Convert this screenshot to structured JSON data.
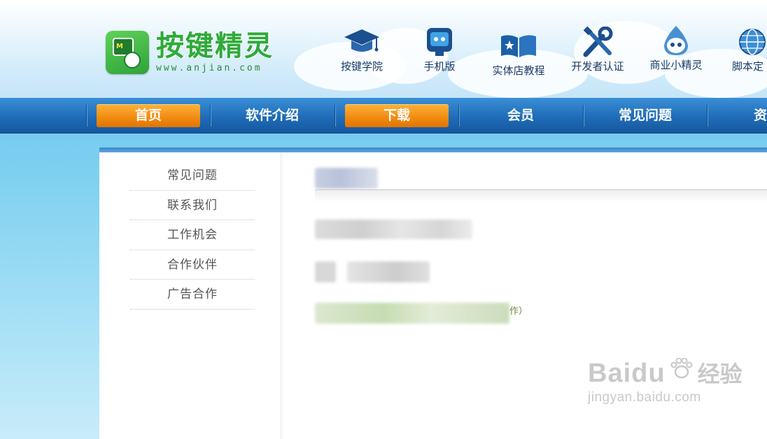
{
  "logo": {
    "title": "按键精灵",
    "mark_letter": "M",
    "url": "www.anjian.com"
  },
  "quick_links": [
    {
      "label": "按键学院",
      "icon": "graduation-cap-icon"
    },
    {
      "label": "手机版",
      "icon": "robot-phone-icon"
    },
    {
      "label": "实体店教程",
      "icon": "open-book-icon"
    },
    {
      "label": "开发者认证",
      "icon": "tools-icon"
    },
    {
      "label": "商业小精灵",
      "icon": "elf-mascot-icon"
    },
    {
      "label": "脚本定",
      "icon": "globe-icon"
    }
  ],
  "nav": [
    {
      "label": "首页",
      "active": true
    },
    {
      "label": "软件介绍",
      "active": false
    },
    {
      "label": "下载",
      "active": true
    },
    {
      "label": "会员",
      "active": false
    },
    {
      "label": "常见问题",
      "active": false
    },
    {
      "label": "资",
      "active": false
    }
  ],
  "sidebar": [
    {
      "label": "常见问题"
    },
    {
      "label": "联系我们"
    },
    {
      "label": "工作机会"
    },
    {
      "label": "合作伙伴"
    },
    {
      "label": "广告合作"
    }
  ],
  "main": {
    "link_tail": "作）"
  },
  "watermark": {
    "brand": "Baidu",
    "brand_cn": "经验",
    "url": "jingyan.baidu.com"
  },
  "colors": {
    "nav_blue": "#1f6cb8",
    "nav_active": "#f08a10",
    "logo_green": "#2faa3a"
  }
}
